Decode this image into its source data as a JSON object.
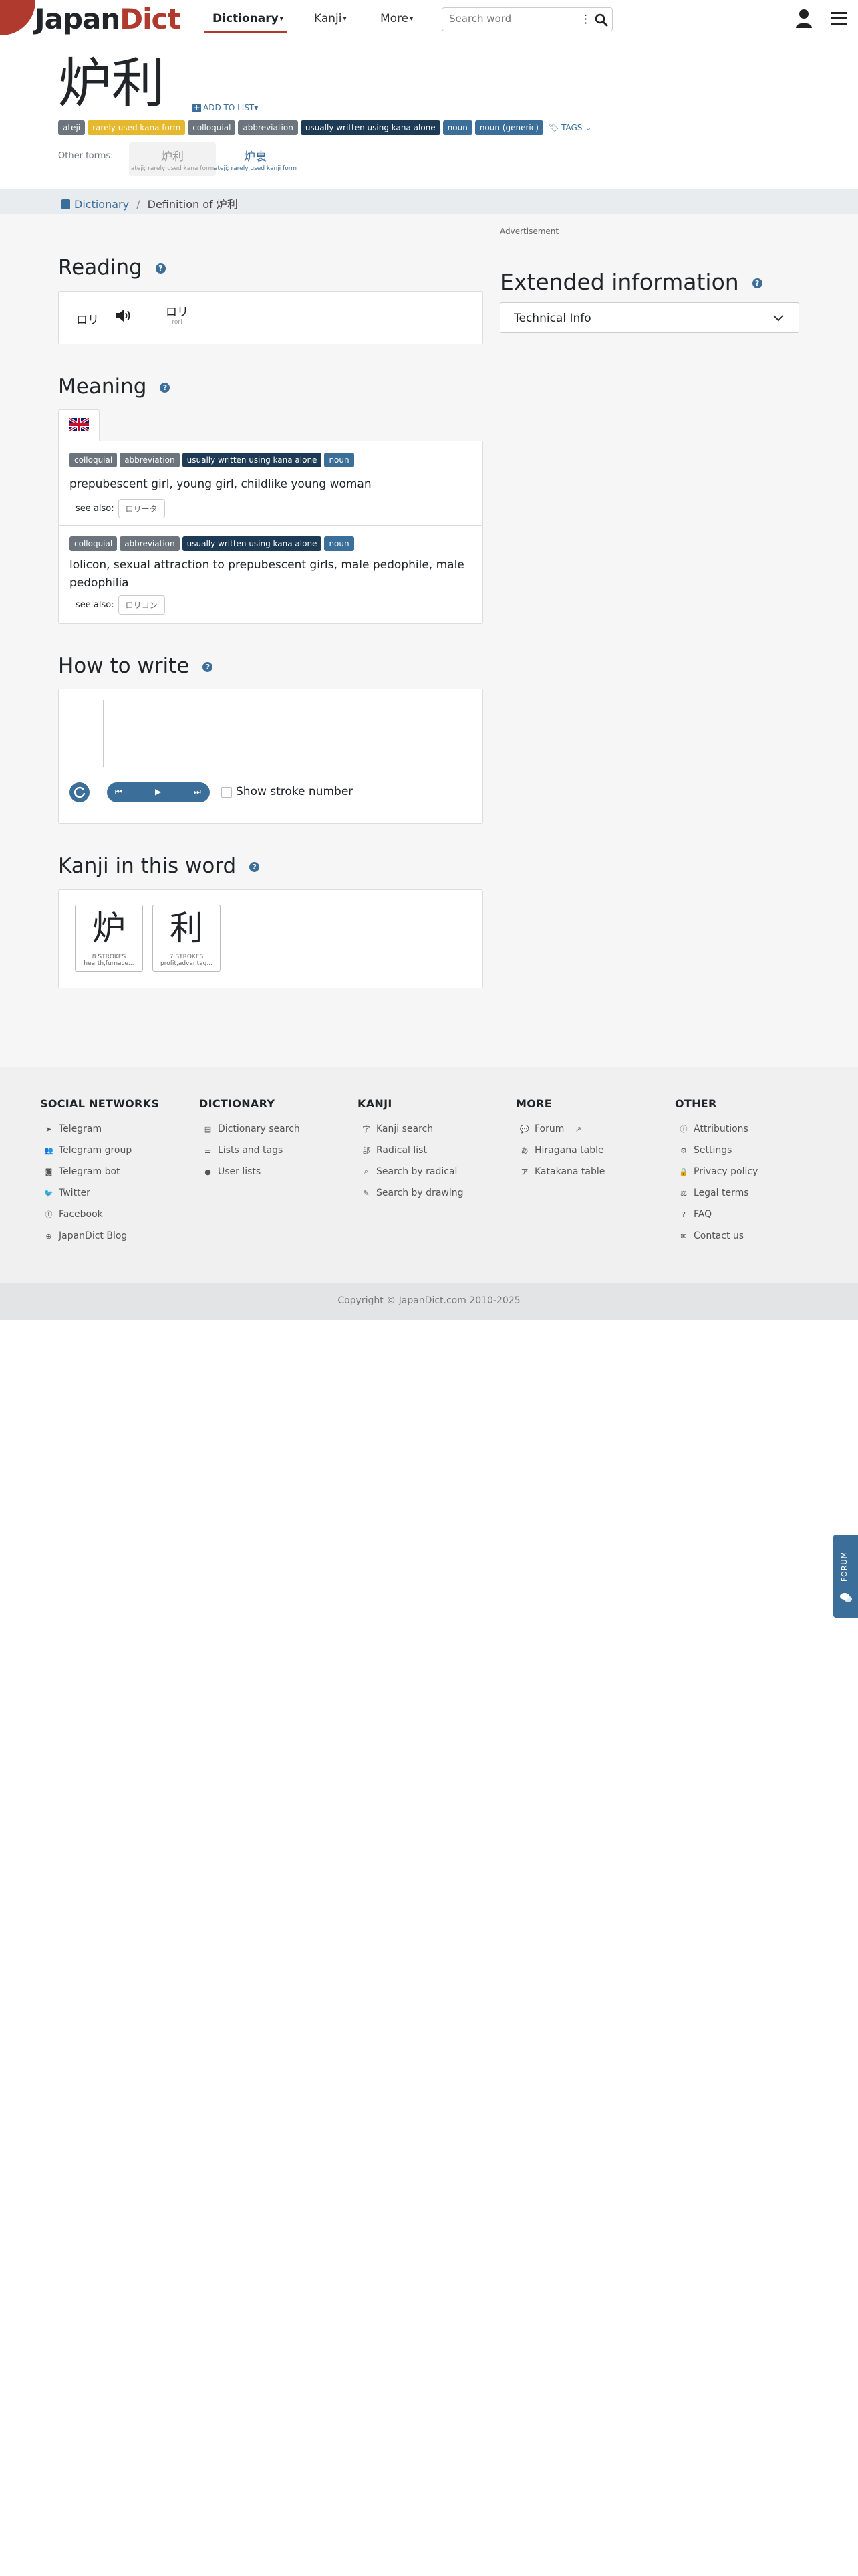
{
  "nav": {
    "logo_part1": "Japan",
    "logo_part2": "Dict",
    "dictionary": "Dictionary",
    "kanji": "Kanji",
    "more": "More",
    "search_placeholder": "Search word"
  },
  "word": {
    "title": "炉利",
    "add_to_list": "ADD TO LIST",
    "tags": [
      {
        "label": "ateji",
        "style": "gray"
      },
      {
        "label": "rarely used kana form",
        "style": "yellow"
      },
      {
        "label": "colloquial",
        "style": "gray"
      },
      {
        "label": "abbreviation",
        "style": "gray"
      },
      {
        "label": "usually written using kana alone",
        "style": "dark"
      },
      {
        "label": "noun",
        "style": "blue"
      },
      {
        "label": "noun (generic)",
        "style": "blue"
      }
    ],
    "tags_button": "TAGS",
    "other_forms_label": "Other forms:",
    "other_forms": [
      {
        "word": "炉利",
        "sub": "ateji; rarely used kana form"
      },
      {
        "word": "炉裏",
        "sub": "ateji; rarely used kanji form"
      }
    ]
  },
  "breadcrumb": {
    "root": "Dictionary",
    "sep": "/",
    "current": "Definition of 炉利"
  },
  "reading": {
    "title": "Reading",
    "kana": "ロリ",
    "furigana": "ロリ",
    "romaji": "rori"
  },
  "meaning": {
    "title": "Meaning",
    "entries": [
      {
        "tags": [
          {
            "label": "colloquial",
            "style": "gray"
          },
          {
            "label": "abbreviation",
            "style": "gray"
          },
          {
            "label": "usually written using kana alone",
            "style": "dark"
          },
          {
            "label": "noun",
            "style": "blue"
          }
        ],
        "text": "prepubescent girl, young girl, childlike young woman",
        "see_also_label": "see also:",
        "see_also": "ロリータ"
      },
      {
        "tags": [
          {
            "label": "colloquial",
            "style": "gray"
          },
          {
            "label": "abbreviation",
            "style": "gray"
          },
          {
            "label": "usually written using kana alone",
            "style": "dark"
          },
          {
            "label": "noun",
            "style": "blue"
          }
        ],
        "text": "lolicon, sexual attraction to prepubescent girls, male pedophile, male pedophilia",
        "see_also_label": "see also:",
        "see_also": "ロリコン"
      }
    ]
  },
  "how_to_write": {
    "title": "How to write",
    "show_stroke_number": "Show stroke number"
  },
  "kanji_in_word": {
    "title": "Kanji in this word",
    "items": [
      {
        "kanji": "炉",
        "strokes": "8 STROKES",
        "meaning": "hearth,furnace..."
      },
      {
        "kanji": "利",
        "strokes": "7 STROKES",
        "meaning": "profit,advantag..."
      }
    ]
  },
  "sidebar": {
    "advertisement": "Advertisement",
    "extended_title": "Extended information",
    "select_value": "Technical Info"
  },
  "footer": {
    "cols": [
      {
        "title": "SOCIAL NETWORKS",
        "items": [
          {
            "label": "Telegram",
            "icon": "paper-plane-icon"
          },
          {
            "label": "Telegram group",
            "icon": "users-icon"
          },
          {
            "label": "Telegram bot",
            "icon": "robot-icon"
          },
          {
            "label": "Twitter",
            "icon": "twitter-icon"
          },
          {
            "label": "Facebook",
            "icon": "facebook-icon"
          },
          {
            "label": "JapanDict Blog",
            "icon": "globe-icon"
          }
        ]
      },
      {
        "title": "DICTIONARY",
        "items": [
          {
            "label": "Dictionary search",
            "icon": "book-icon"
          },
          {
            "label": "Lists and tags",
            "icon": "list-icon"
          },
          {
            "label": "User lists",
            "icon": "user-icon"
          }
        ]
      },
      {
        "title": "KANJI",
        "items": [
          {
            "label": "Kanji search",
            "icon": "kanji-icon"
          },
          {
            "label": "Radical list",
            "icon": "radical-icon"
          },
          {
            "label": "Search by radical",
            "icon": "search-icon"
          },
          {
            "label": "Search by drawing",
            "icon": "pencil-icon"
          }
        ]
      },
      {
        "title": "MORE",
        "items": [
          {
            "label": "Forum",
            "icon": "comments-icon"
          },
          {
            "label": "Hiragana table",
            "icon": "hiragana-icon"
          },
          {
            "label": "Katakana table",
            "icon": "katakana-icon"
          }
        ]
      },
      {
        "title": "OTHER",
        "items": [
          {
            "label": "Attributions",
            "icon": "info-icon"
          },
          {
            "label": "Settings",
            "icon": "gear-icon"
          },
          {
            "label": "Privacy policy",
            "icon": "user-lock-icon"
          },
          {
            "label": "Legal terms",
            "icon": "scale-icon"
          },
          {
            "label": "FAQ",
            "icon": "question-icon"
          },
          {
            "label": "Contact us",
            "icon": "envelope-icon"
          }
        ]
      }
    ],
    "copyright": "Copyright © JapanDict.com 2010-2025"
  },
  "forum_tab": "FORUM",
  "colors": {
    "brand": "#b03a2e",
    "accent": "#3b6e99",
    "dark_tag": "#1e3b55",
    "yellow_tag": "#e6b82e"
  }
}
